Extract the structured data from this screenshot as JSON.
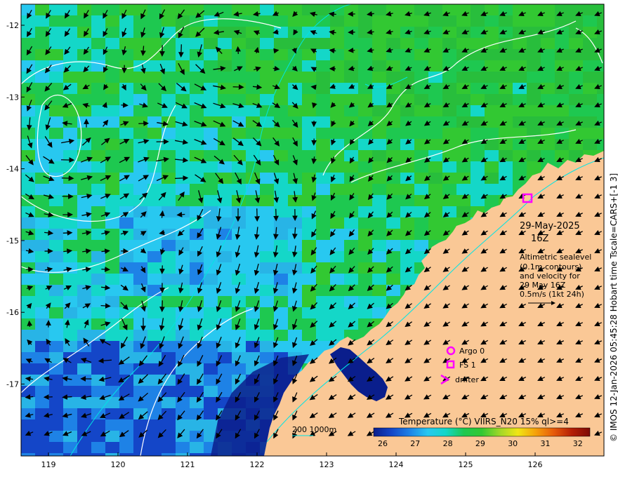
{
  "date_label": "29-May-2025",
  "time_label": "16Z",
  "info": {
    "line1": "Altimetric sealevel",
    "line2": "(0.1m contours)",
    "line3": "and velocity for",
    "line4": "29 May 16Z",
    "line5": "0.5m/s (1kt 24h)"
  },
  "legend": {
    "argo": "Argo 0",
    "fs": "FS 1",
    "drifter": "drifter",
    "argo_color": "#ff00ff",
    "fs_color": "#ff00ff"
  },
  "depth_contours_label": "200  1000m",
  "colorbar": {
    "title": "Temperature (°C) VIIRS_N20 15% ql>=4",
    "ticks": [
      "26",
      "27",
      "28",
      "29",
      "30",
      "31",
      "32"
    ],
    "colors": [
      "#0a1e8c",
      "#1446c8",
      "#1e82e6",
      "#28c8f0",
      "#14d7c8",
      "#1ec850",
      "#32c832",
      "#a0d728",
      "#f0e614",
      "#f5a00a",
      "#e65a0a",
      "#b41e05",
      "#7d0a05"
    ]
  },
  "credit": "© IMOS 12-Jan-2026 05:45:28 Hobart time Tscale=CARS+[-1 3]",
  "axes": {
    "x_ticks": [
      "119",
      "120",
      "121",
      "122",
      "123",
      "124",
      "125",
      "126"
    ],
    "y_ticks": [
      "-12",
      "-13",
      "-14",
      "-15",
      "-16",
      "-17"
    ]
  },
  "colors": {
    "land": "#fac896",
    "contour": "#ffffff",
    "bathy": "#00e5e5",
    "arrows": "#000000"
  }
}
